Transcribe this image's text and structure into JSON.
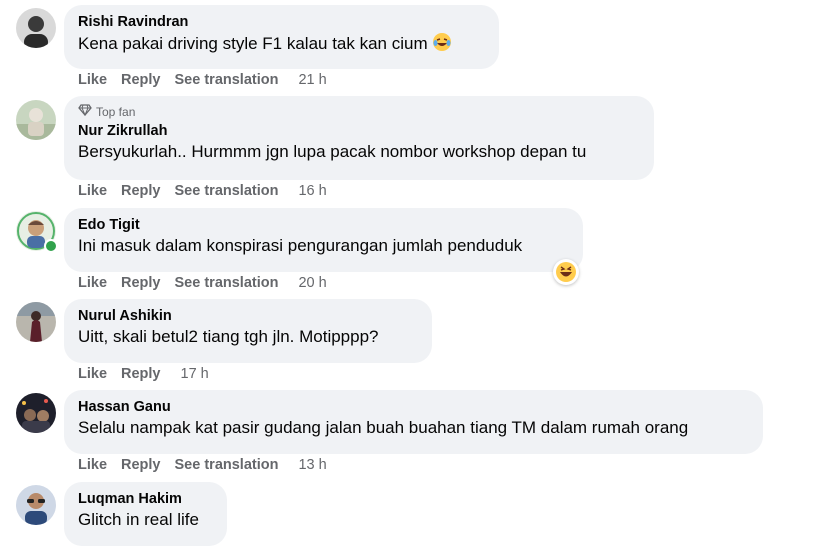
{
  "actions": {
    "like": "Like",
    "reply": "Reply",
    "see_translation": "See translation"
  },
  "comments": [
    {
      "name": "Rishi Ravindran",
      "text": "Kena pakai driving style F1 kalau tak kan cium",
      "time": "21 h",
      "emoji": "laughing-tears-icon"
    },
    {
      "badge": "Top fan",
      "name": "Nur Zikrullah",
      "text": "Bersyukurlah.. Hurmmm jgn lupa pacak nombor workshop depan tu",
      "time": "16 h"
    },
    {
      "name": "Edo Tigit",
      "text": "Ini masuk dalam konspirasi pengurangan jumlah penduduk",
      "time": "20 h",
      "reaction": "haha-reaction-icon",
      "online": true
    },
    {
      "name": "Nurul Ashikin",
      "text": "Uitt, skali betul2 tiang tgh jln. Motipppp?",
      "time": "17 h"
    },
    {
      "name": "Hassan Ganu",
      "text": "Selalu nampak kat pasir gudang jalan buah buahan tiang TM dalam rumah orang",
      "time": "13 h"
    },
    {
      "name": "Luqman Hakim",
      "text": "Glitch in real life"
    }
  ],
  "colors": {
    "bubble": "#f0f2f5",
    "meta": "#65676b",
    "text": "#050505",
    "online": "#31a24c"
  }
}
